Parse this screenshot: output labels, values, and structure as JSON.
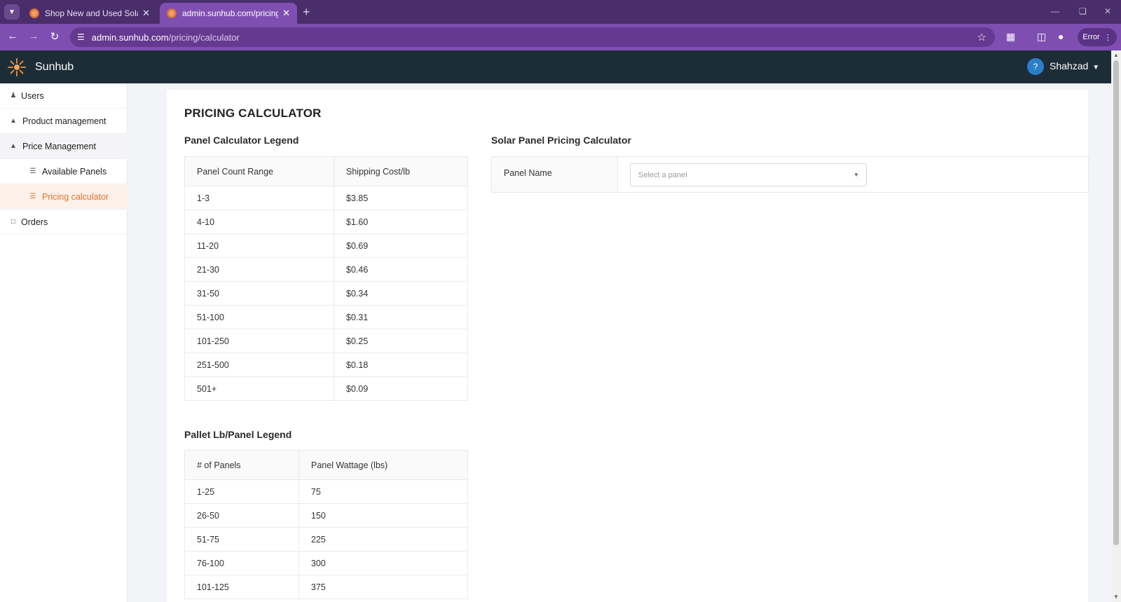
{
  "browser": {
    "tabs": [
      {
        "title": "Shop New and Used Solar Pane",
        "active": false
      },
      {
        "title": "admin.sunhub.com/pricing/calc",
        "active": true
      }
    ],
    "url_host": "admin.sunhub.com",
    "url_path": "/pricing/calculator",
    "error_label": "Error"
  },
  "app": {
    "brand": "Sunhub",
    "help_label": "?",
    "user_name": "Shahzad"
  },
  "sidebar": {
    "items": [
      {
        "label": "Users"
      },
      {
        "label": "Product management"
      },
      {
        "label": "Price Management"
      },
      {
        "label": "Available Panels"
      },
      {
        "label": "Pricing calculator"
      },
      {
        "label": "Orders"
      }
    ]
  },
  "page": {
    "title": "PRICING CALCULATOR",
    "panel_legend": {
      "title": "Panel Calculator Legend",
      "headers": [
        "Panel Count Range",
        "Shipping Cost/lb"
      ],
      "rows": [
        [
          "1-3",
          "$3.85"
        ],
        [
          "4-10",
          "$1.60"
        ],
        [
          "11-20",
          "$0.69"
        ],
        [
          "21-30",
          "$0.46"
        ],
        [
          "31-50",
          "$0.34"
        ],
        [
          "51-100",
          "$0.31"
        ],
        [
          "101-250",
          "$0.25"
        ],
        [
          "251-500",
          "$0.18"
        ],
        [
          "501+",
          "$0.09"
        ]
      ]
    },
    "pallet_legend": {
      "title": "Pallet Lb/Panel Legend",
      "headers": [
        "# of Panels",
        "Panel Wattage (lbs)"
      ],
      "rows": [
        [
          "1-25",
          "75"
        ],
        [
          "26-50",
          "150"
        ],
        [
          "51-75",
          "225"
        ],
        [
          "76-100",
          "300"
        ],
        [
          "101-125",
          "375"
        ]
      ]
    },
    "calculator": {
      "title": "Solar Panel Pricing Calculator",
      "panel_name_label": "Panel Name",
      "panel_placeholder": "Select a panel"
    }
  },
  "colors": {
    "tabbar": "#4a2d6b",
    "addressbar": "#7e4fb1",
    "app_header": "#1c2d38",
    "accent": "#e0742f"
  }
}
